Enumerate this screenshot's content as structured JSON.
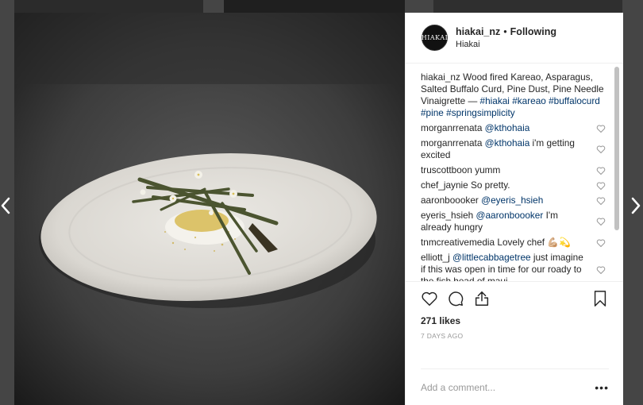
{
  "post": {
    "username": "hiakai_nz",
    "follow_status": "Following",
    "separator": "•",
    "location": "Hiakai",
    "avatar_text": "HIAKAI"
  },
  "caption": {
    "username": "hiakai_nz",
    "text": "Wood fired Kareao, Asparagus, Salted Buffalo Curd, Pine Dust, Pine Needle Vinaigrette —",
    "hashtags": "#hiakai #kareao #buffalocurd #pine #springsimplicity"
  },
  "comments": [
    {
      "user": "morganrrenata",
      "mention": "@kthohaia",
      "text": ""
    },
    {
      "user": "morganrrenata",
      "mention": "@kthohaia",
      "text": "i'm getting excited"
    },
    {
      "user": "truscottboon",
      "mention": "",
      "text": "yumm"
    },
    {
      "user": "chef_jaynie",
      "mention": "",
      "text": "So pretty."
    },
    {
      "user": "aaronboooker",
      "mention": "@eyeris_hsieh",
      "text": ""
    },
    {
      "user": "eyeris_hsieh",
      "mention": "@aaronboooker",
      "text": "I'm already hungry"
    },
    {
      "user": "tnmcreativemedia",
      "mention": "",
      "text": "Lovely chef 💪🏼💫"
    },
    {
      "user": "elliott_j",
      "mention": "@littlecabbagetree",
      "text": "just imagine if this was open in time for our roady to the fish head of maui.."
    }
  ],
  "actions": {
    "likes": "271 likes",
    "date": "7 DAYS AGO"
  },
  "add_comment": {
    "placeholder": "Add a comment...",
    "more": "•••"
  },
  "icons": {
    "prev": "chevron-left-icon",
    "next": "chevron-right-icon",
    "like": "heart-icon",
    "comment": "comment-bubble-icon",
    "share": "share-icon",
    "save": "bookmark-icon"
  }
}
